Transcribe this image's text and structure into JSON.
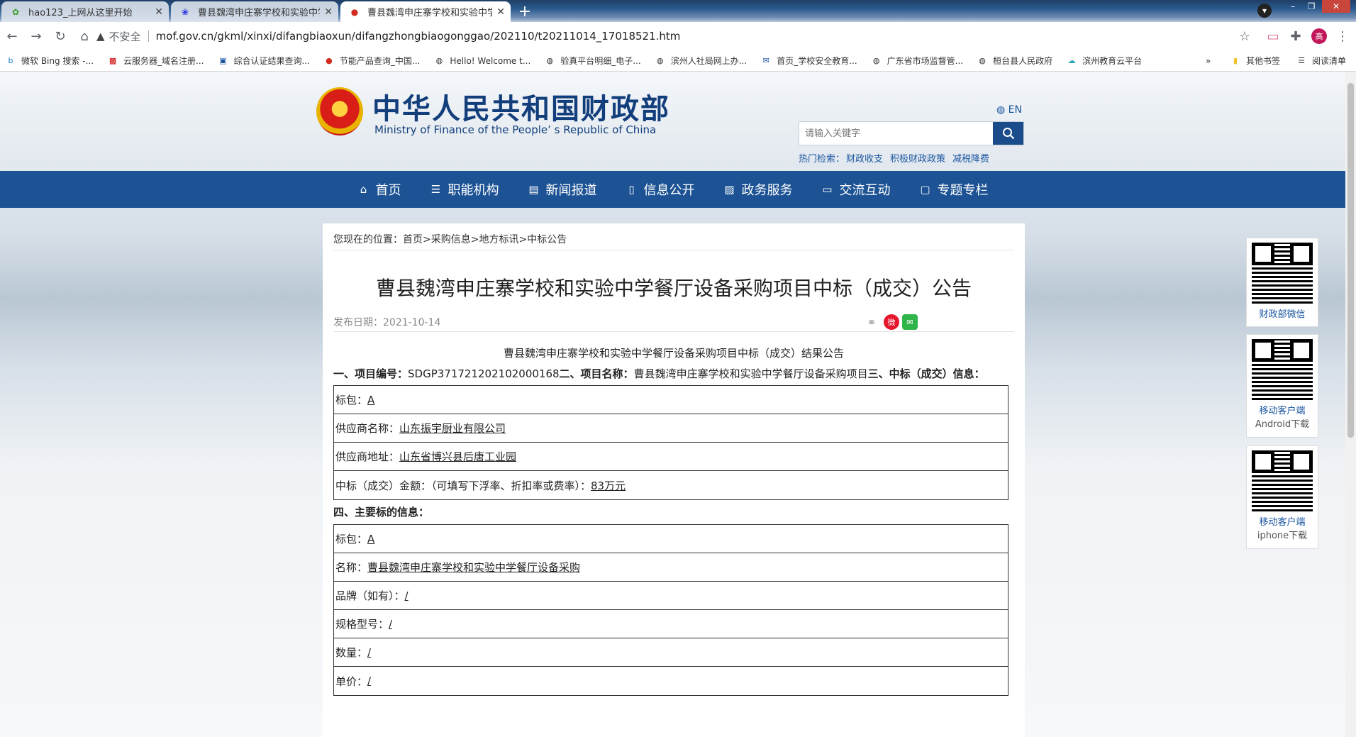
{
  "browser": {
    "tabs": [
      {
        "title": "hao123_上网从这里开始",
        "icon": "hao123-icon"
      },
      {
        "title": "曹县魏湾申庄寨学校和实验中学餐厅",
        "icon": "baidu-paw-icon"
      },
      {
        "title": "曹县魏湾申庄寨学校和实验中学",
        "icon": "mof-emblem-icon"
      }
    ],
    "address": {
      "security": "不安全",
      "url": "mof.gov.cn/gkml/xinxi/difangbiaoxun/difangzhongbiaogonggao/202110/t20211014_17018521.htm"
    },
    "bookmarks": [
      "微软 Bing 搜索 -...",
      "云服务器_域名注册...",
      "综合认证结果查询...",
      "节能产品查询_中国...",
      "Hello! Welcome t...",
      "验真平台明细_电子...",
      "滨州人社局网上办...",
      "首页_学校安全教育...",
      "广东省市场监督管...",
      "桓台县人民政府",
      "滨州教育云平台"
    ],
    "other_bookmarks": "其他书签",
    "reading_list": "阅读清单",
    "profile_initial": "高"
  },
  "site": {
    "logo_cn": "中华人民共和国财政部",
    "logo_en": "Ministry of Finance of the People’ s Republic of China",
    "lang": "EN",
    "search_placeholder": "请输入关键字",
    "hot_label": "热门检索：",
    "hot_terms": [
      "财政收支",
      "积极财政政策",
      "减税降费"
    ],
    "nav": [
      "首页",
      "职能机构",
      "新闻报道",
      "信息公开",
      "政务服务",
      "交流互动",
      "专题专栏"
    ]
  },
  "article": {
    "breadcrumb": "您现在的位置：首页>采购信息>地方标讯>中标公告",
    "title": "曹县魏湾申庄寨学校和实验中学餐厅设备采购项目中标（成交）公告",
    "date": "发布日期：2021-10-14",
    "subtitle": "曹县魏湾申庄寨学校和实验中学餐厅设备采购项目中标（成交）结果公告",
    "line1_a": "一、项目编号：",
    "line1_b": "SDGP371721202102000168",
    "line1_c": "二、项目名称：",
    "line1_d": "曹县魏湾申庄寨学校和实验中学餐厅设备采购项目",
    "line1_e": "三、中标（成交）信息：",
    "winner_rows": [
      {
        "label": "标包：",
        "value": "A"
      },
      {
        "label": "供应商名称：",
        "value": "山东振宇厨业有限公司"
      },
      {
        "label": "供应商地址：",
        "value": "山东省博兴县后唐工业园"
      },
      {
        "label": "中标（成交）金额：（可填写下浮率、折扣率或费率）：",
        "value": "83万元"
      }
    ],
    "section4": "四、主要标的信息：",
    "item_rows": [
      {
        "label": "标包：",
        "value": "A"
      },
      {
        "label": "名称：",
        "value": "曹县魏湾申庄寨学校和实验中学餐厅设备采购"
      },
      {
        "label": "品牌（如有）：",
        "value": "/"
      },
      {
        "label": "规格型号：",
        "value": "/"
      },
      {
        "label": "数量：",
        "value": "/"
      },
      {
        "label": "单价：",
        "value": "/"
      }
    ]
  },
  "side_qr": [
    {
      "line1": "财政部微信",
      "line2": ""
    },
    {
      "line1": "移动客户端",
      "line2": "Android下载"
    },
    {
      "line1": "移动客户端",
      "line2": "iphone下载"
    }
  ]
}
